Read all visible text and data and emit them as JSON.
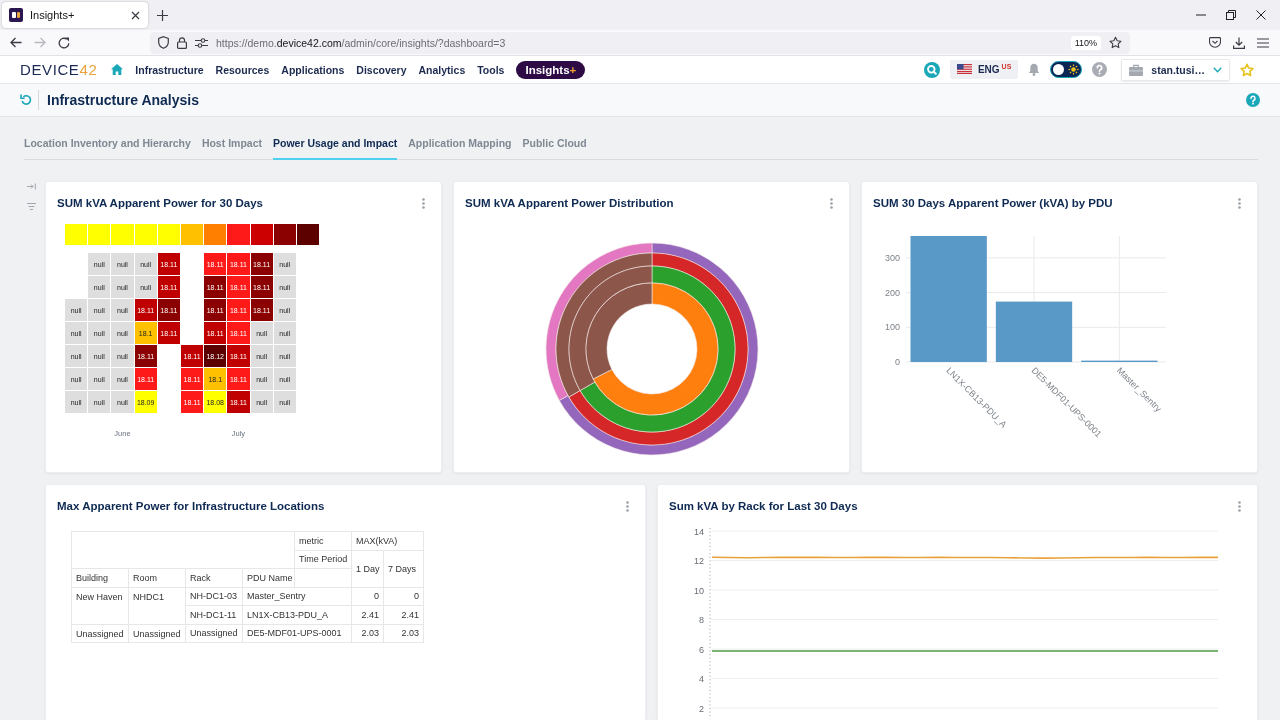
{
  "browser": {
    "tab_title": "Insights+",
    "url": {
      "prefix": "https://demo.",
      "domain": "device42.com",
      "path": "/admin/core/insights/?dashboard=3"
    },
    "zoom": "110%"
  },
  "app_nav": {
    "logo": {
      "text": "DEVICE",
      "accent": "42"
    },
    "items": [
      {
        "label": "Infrastructure",
        "selected": false
      },
      {
        "label": "Resources",
        "selected": false
      },
      {
        "label": "Applications",
        "selected": false
      },
      {
        "label": "Discovery",
        "selected": false
      },
      {
        "label": "Analytics",
        "selected": false
      },
      {
        "label": "Tools",
        "selected": false
      },
      {
        "label": "Insights",
        "suffix": "+",
        "selected": true
      }
    ],
    "language": {
      "code": "ENG",
      "region": "US"
    },
    "dark_mode": false,
    "user": "stan.tusi…"
  },
  "page_header": {
    "title": "Infrastructure Analysis"
  },
  "tabs": [
    {
      "label": "Location Inventory and Hierarchy",
      "selected": false
    },
    {
      "label": "Host Impact",
      "selected": false
    },
    {
      "label": "Power Usage and Impact",
      "selected": true
    },
    {
      "label": "Application Mapping",
      "selected": false
    },
    {
      "label": "Public Cloud",
      "selected": false
    }
  ],
  "dashboard_rows": [
    {
      "cards": [
        {
          "kind": "heatmap",
          "title": "SUM kVA Apparent Power for 30 Days",
          "legend": [
            {
              "color": "#ffff00"
            },
            {
              "color": "#ffff00"
            },
            {
              "color": "#ffff00"
            },
            {
              "color": "#ffff00"
            },
            {
              "color": "#ffff00"
            },
            {
              "color": "#ffc000"
            },
            {
              "color": "#ff8000"
            },
            {
              "color": "#ff1a1a"
            },
            {
              "color": "#cc0000"
            },
            {
              "color": "#8b0000"
            },
            {
              "color": "#5c0000"
            }
          ],
          "months": [
            {
              "label": "June",
              "weeks": [
                [
                  {
                    "kind": "blank"
                  },
                  {
                    "kind": "blank"
                  },
                  {
                    "kind": "value",
                    "text": "null",
                    "color": "#dedede"
                  },
                  {
                    "kind": "value",
                    "text": "null",
                    "color": "#dedede"
                  },
                  {
                    "kind": "value",
                    "text": "null",
                    "color": "#dedede"
                  },
                  {
                    "kind": "value",
                    "text": "null",
                    "color": "#dedede"
                  },
                  {
                    "kind": "value",
                    "text": "null",
                    "color": "#dedede"
                  }
                ],
                [
                  {
                    "kind": "value",
                    "text": "null",
                    "color": "#dedede"
                  },
                  {
                    "kind": "value",
                    "text": "null",
                    "color": "#dedede"
                  },
                  {
                    "kind": "value",
                    "text": "null",
                    "color": "#dedede"
                  },
                  {
                    "kind": "value",
                    "text": "null",
                    "color": "#dedede"
                  },
                  {
                    "kind": "value",
                    "text": "null",
                    "color": "#dedede"
                  },
                  {
                    "kind": "value",
                    "text": "null",
                    "color": "#dedede"
                  },
                  {
                    "kind": "value",
                    "text": "null",
                    "color": "#dedede"
                  }
                ],
                [
                  {
                    "kind": "value",
                    "text": "null",
                    "color": "#dedede"
                  },
                  {
                    "kind": "value",
                    "text": "null",
                    "color": "#dedede"
                  },
                  {
                    "kind": "value",
                    "text": "null",
                    "color": "#dedede"
                  },
                  {
                    "kind": "value",
                    "text": "null",
                    "color": "#dedede"
                  },
                  {
                    "kind": "value",
                    "text": "null",
                    "color": "#dedede"
                  },
                  {
                    "kind": "value",
                    "text": "null",
                    "color": "#dedede"
                  },
                  {
                    "kind": "value",
                    "text": "null",
                    "color": "#dedede"
                  }
                ],
                [
                  {
                    "kind": "value",
                    "text": "null",
                    "color": "#dedede"
                  },
                  {
                    "kind": "value",
                    "text": "null",
                    "color": "#dedede"
                  },
                  {
                    "kind": "value",
                    "text": "18.11",
                    "color": "#c00000"
                  },
                  {
                    "kind": "value",
                    "text": "18.1",
                    "color": "#ffc000"
                  },
                  {
                    "kind": "value",
                    "text": "18.11",
                    "color": "#8b0000"
                  },
                  {
                    "kind": "value",
                    "text": "18.11",
                    "color": "#ff1a1a"
                  },
                  {
                    "kind": "value",
                    "text": "18.09",
                    "color": "#ffff00"
                  }
                ],
                [
                  {
                    "kind": "value",
                    "text": "18.11",
                    "color": "#c00000"
                  },
                  {
                    "kind": "value",
                    "text": "18.11",
                    "color": "#c00000"
                  },
                  {
                    "kind": "value",
                    "text": "18.11",
                    "color": "#8b0000"
                  },
                  {
                    "kind": "value",
                    "text": "18.11",
                    "color": "#c00000"
                  },
                  {
                    "kind": "blank"
                  },
                  {
                    "kind": "blank"
                  },
                  {
                    "kind": "blank"
                  }
                ]
              ]
            },
            {
              "label": "July",
              "weeks": [
                [
                  {
                    "kind": "blank"
                  },
                  {
                    "kind": "blank"
                  },
                  {
                    "kind": "blank"
                  },
                  {
                    "kind": "blank"
                  },
                  {
                    "kind": "value",
                    "text": "18.11",
                    "color": "#c00000"
                  },
                  {
                    "kind": "value",
                    "text": "18.11",
                    "color": "#ff1a1a"
                  },
                  {
                    "kind": "value",
                    "text": "18.11",
                    "color": "#ff1a1a"
                  }
                ],
                [
                  {
                    "kind": "value",
                    "text": "18.11",
                    "color": "#ff1a1a"
                  },
                  {
                    "kind": "value",
                    "text": "18.11",
                    "color": "#8b0000"
                  },
                  {
                    "kind": "value",
                    "text": "18.11",
                    "color": "#8b0000"
                  },
                  {
                    "kind": "value",
                    "text": "18.11",
                    "color": "#c00000"
                  },
                  {
                    "kind": "value",
                    "text": "18.12",
                    "color": "#5c0000"
                  },
                  {
                    "kind": "value",
                    "text": "18.1",
                    "color": "#ffc000"
                  },
                  {
                    "kind": "value",
                    "text": "18.08",
                    "color": "#ffff00"
                  }
                ],
                [
                  {
                    "kind": "value",
                    "text": "18.11",
                    "color": "#ff1a1a"
                  },
                  {
                    "kind": "value",
                    "text": "18.11",
                    "color": "#ff1a1a"
                  },
                  {
                    "kind": "value",
                    "text": "18.11",
                    "color": "#ff1a1a"
                  },
                  {
                    "kind": "value",
                    "text": "18.11",
                    "color": "#ff1a1a"
                  },
                  {
                    "kind": "value",
                    "text": "18.11",
                    "color": "#c00000"
                  },
                  {
                    "kind": "value",
                    "text": "18.11",
                    "color": "#ff1a1a"
                  },
                  {
                    "kind": "value",
                    "text": "18.11",
                    "color": "#c00000"
                  }
                ],
                [
                  {
                    "kind": "value",
                    "text": "18.11",
                    "color": "#8b0000"
                  },
                  {
                    "kind": "value",
                    "text": "18.11",
                    "color": "#8b0000"
                  },
                  {
                    "kind": "value",
                    "text": "18.11",
                    "color": "#8b0000"
                  },
                  {
                    "kind": "value",
                    "text": "null",
                    "color": "#dedede"
                  },
                  {
                    "kind": "value",
                    "text": "null",
                    "color": "#dedede"
                  },
                  {
                    "kind": "value",
                    "text": "null",
                    "color": "#dedede"
                  },
                  {
                    "kind": "value",
                    "text": "null",
                    "color": "#dedede"
                  }
                ],
                [
                  {
                    "kind": "value",
                    "text": "null",
                    "color": "#dedede"
                  },
                  {
                    "kind": "value",
                    "text": "null",
                    "color": "#dedede"
                  },
                  {
                    "kind": "value",
                    "text": "null",
                    "color": "#dedede"
                  },
                  {
                    "kind": "value",
                    "text": "null",
                    "color": "#dedede"
                  },
                  {
                    "kind": "value",
                    "text": "null",
                    "color": "#dedede"
                  },
                  {
                    "kind": "value",
                    "text": "null",
                    "color": "#dedede"
                  },
                  {
                    "kind": "value",
                    "text": "null",
                    "color": "#dedede"
                  }
                ]
              ]
            }
          ]
        },
        {
          "kind": "sunburst",
          "title": "SUM kVA Apparent Power Distribution"
        },
        {
          "kind": "chart",
          "title": "SUM 30 Days Apparent Power (kVA) by PDU",
          "chart_data": {
            "type": "bar",
            "categories": [
              "LN1X-CB13-PDU_A",
              "DE5-MDF01-UPS-0001",
              "Master_Sentry"
            ],
            "values": [
              363,
              174,
              4
            ],
            "ylim": [
              0,
              363
            ],
            "yticks": [
              0,
              100,
              200,
              300
            ],
            "grid": true
          }
        }
      ]
    },
    {
      "cards": [
        {
          "kind": "pivot_table",
          "title": "Max Apparent Power for Infrastructure Locations",
          "table": {
            "metric_label": "metric",
            "metric": "MAX(kVA)",
            "period_label": "Time Period",
            "periods": [
              "1 Day",
              "7 Days"
            ],
            "columns": [
              "Building",
              "Room",
              "Rack",
              "PDU Name"
            ],
            "groups": [
              {
                "building": "New Haven",
                "room": "NHDC1",
                "racks": [
                  {
                    "rack": "NH-DC1-03",
                    "pdu": "Master_Sentry",
                    "values": [
                      "0",
                      "0"
                    ]
                  },
                  {
                    "rack": "NH-DC1-11",
                    "pdu": "LN1X-CB13-PDU_A",
                    "values": [
                      "2.41",
                      "2.41"
                    ]
                  }
                ]
              },
              {
                "building": "Unassigned",
                "room": "Unassigned",
                "racks": [
                  {
                    "rack": "Unassigned",
                    "pdu": "DE5-MDF01-UPS-0001",
                    "values": [
                      "2.03",
                      "2.03"
                    ]
                  }
                ]
              }
            ]
          }
        },
        {
          "kind": "chart",
          "title": "Sum kVA by Rack for Last 30 Days",
          "chart_data": {
            "type": "line",
            "series": [
              {
                "color": "#e9a23b",
                "values": [
                  12.22,
                  12.2,
                  12.19,
                  12.2,
                  12.21,
                  12.21,
                  12.21,
                  12.2,
                  12.2,
                  12.21,
                  12.21,
                  12.2,
                  12.2,
                  12.21,
                  12.2,
                  12.2,
                  12.2,
                  12.19,
                  12.17,
                  12.16,
                  12.17,
                  12.19,
                  12.2,
                  12.2,
                  12.2,
                  12.21,
                  12.2,
                  12.2,
                  12.21,
                  12.21
                ]
              },
              {
                "color": "#4e9d45",
                "values": [
                  5.86,
                  5.86,
                  5.86,
                  5.86,
                  5.86,
                  5.86,
                  5.86,
                  5.86,
                  5.86,
                  5.86,
                  5.86,
                  5.86,
                  5.86,
                  5.86,
                  5.86,
                  5.86,
                  5.86,
                  5.86,
                  5.86,
                  5.86,
                  5.86,
                  5.86,
                  5.86,
                  5.86,
                  5.86,
                  5.86,
                  5.86,
                  5.86,
                  5.86,
                  5.86
                ]
              }
            ],
            "ylim": [
              2,
              14
            ],
            "yticks": [
              2,
              4,
              6,
              8,
              10,
              12,
              14
            ],
            "grid": true
          }
        }
      ]
    }
  ]
}
